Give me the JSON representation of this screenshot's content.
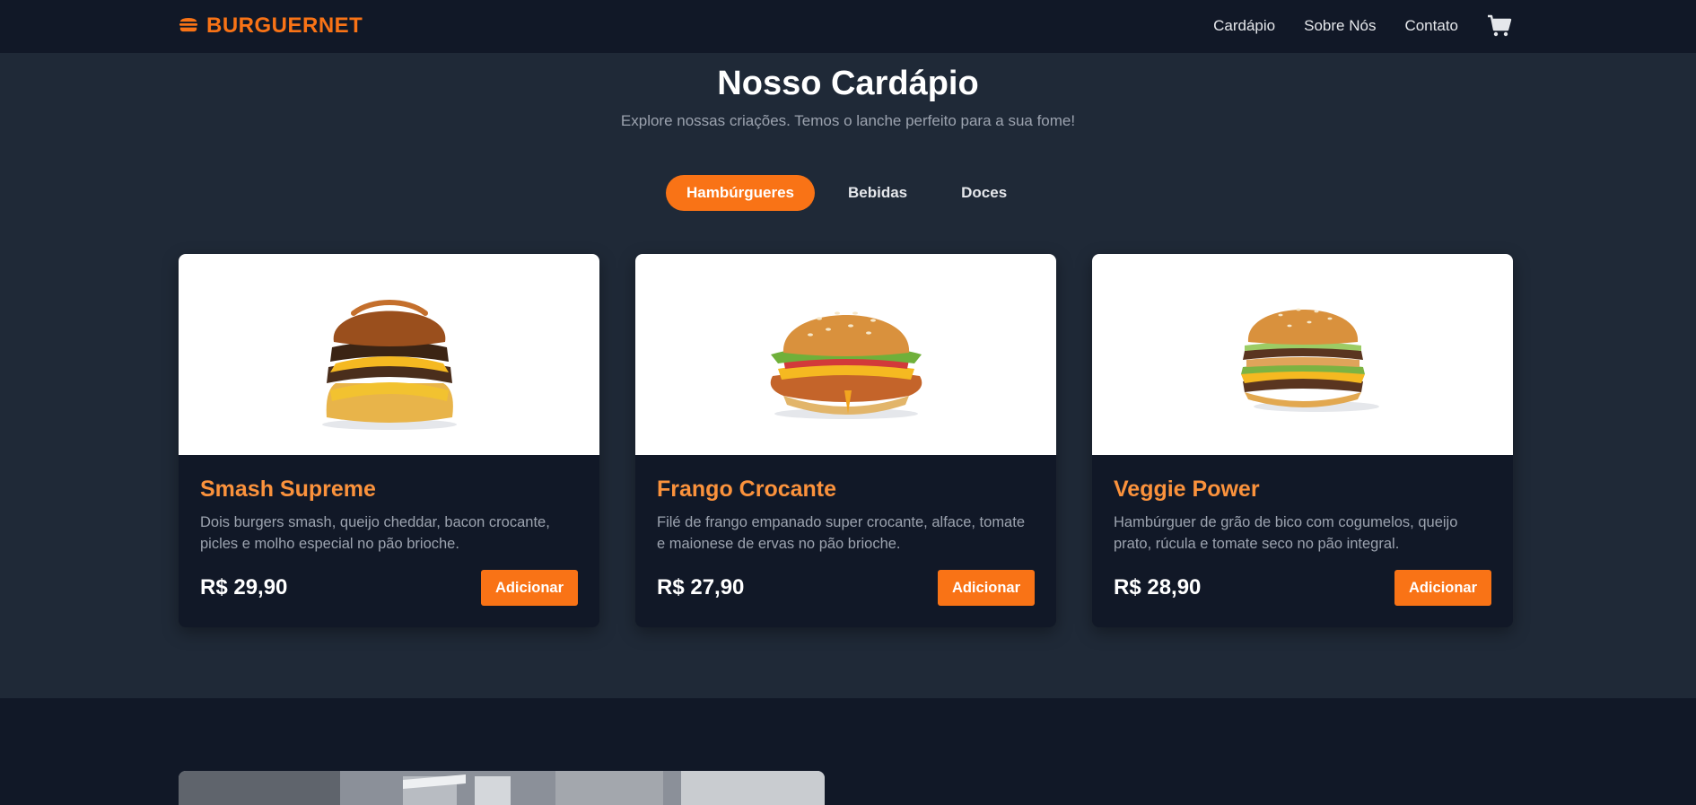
{
  "header": {
    "logo_text": "BURGUERNET",
    "nav": [
      "Cardápio",
      "Sobre Nós",
      "Contato"
    ]
  },
  "menu": {
    "title": "Nosso Cardápio",
    "subtitle": "Explore nossas criações. Temos o lanche perfeito para a sua fome!",
    "tabs": [
      "Hambúrgueres",
      "Bebidas",
      "Doces"
    ],
    "active_tab": "Hambúrgueres"
  },
  "products": [
    {
      "name": "Smash Supreme",
      "description": "Dois burgers smash, queijo cheddar, bacon crocante, picles e molho especial no pão brioche.",
      "price": "R$ 29,90",
      "button": "Adicionar"
    },
    {
      "name": "Frango Crocante",
      "description": "Filé de frango empanado super crocante, alface, tomate e maionese de ervas no pão brioche.",
      "price": "R$ 27,90",
      "button": "Adicionar"
    },
    {
      "name": "Veggie Power",
      "description": "Hambúrguer de grão de bico com cogumelos, queijo prato, rúcula e tomate seco no pão integral.",
      "price": "R$ 28,90",
      "button": "Adicionar"
    }
  ],
  "colors": {
    "accent": "#f97316",
    "header_bg": "#111827",
    "page_bg": "#1f2937"
  },
  "icons": {
    "logo": "burger-icon",
    "cart": "cart-icon"
  }
}
